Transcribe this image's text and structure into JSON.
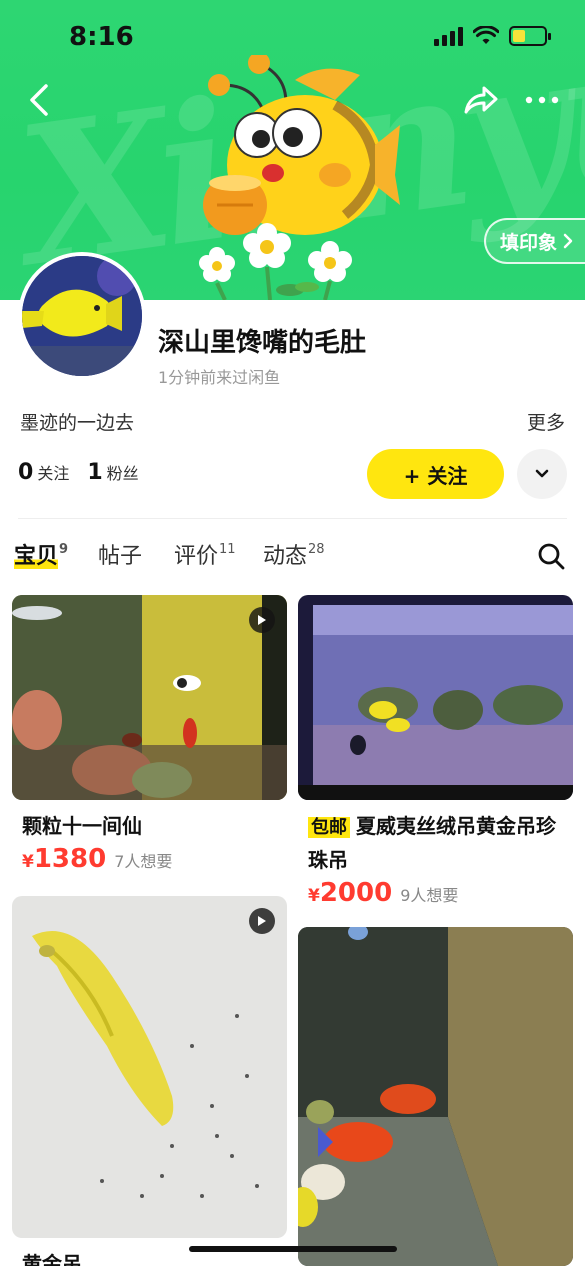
{
  "status": {
    "time": "8:16"
  },
  "banner": {
    "script_text": "Xianyu",
    "stamp_button": "填印象"
  },
  "profile": {
    "nickname": "深山里馋嘴的毛肚",
    "last_seen": "1分钟前来过闲鱼",
    "bio": "墨迹的一边去",
    "more_link": "更多",
    "following_count": "0",
    "following_label": "关注",
    "followers_count": "1",
    "followers_label": "粉丝",
    "follow_button": "+ 关注"
  },
  "tabs": [
    {
      "label": "宝贝",
      "count": "9",
      "active": true
    },
    {
      "label": "帖子",
      "count": "",
      "active": false
    },
    {
      "label": "评价",
      "count": "11",
      "active": false
    },
    {
      "label": "动态",
      "count": "28",
      "active": false
    }
  ],
  "items": [
    {
      "title": "颗粒十一间仙",
      "tag": "",
      "currency": "¥",
      "price": "1380",
      "wants": "7人想要",
      "has_video": true
    },
    {
      "title": "夏威夷丝绒吊黄金吊珍珠吊",
      "tag": "包邮",
      "currency": "¥",
      "price": "2000",
      "wants": "9人想要",
      "has_video": false
    },
    {
      "title": "黄金吊",
      "tag": "",
      "currency": "",
      "price": "",
      "wants": "",
      "has_video": true
    },
    {
      "title": "",
      "tag": "",
      "currency": "",
      "price": "",
      "wants": "",
      "has_video": false
    }
  ],
  "colors": {
    "banner_green": "#2ed672",
    "accent_yellow": "#ffe60f",
    "price_red": "#ff3b30"
  },
  "icons": [
    "back-icon",
    "share-icon",
    "more-dots-icon",
    "chevron-right-icon",
    "chevron-down-icon",
    "search-icon",
    "play-icon"
  ]
}
